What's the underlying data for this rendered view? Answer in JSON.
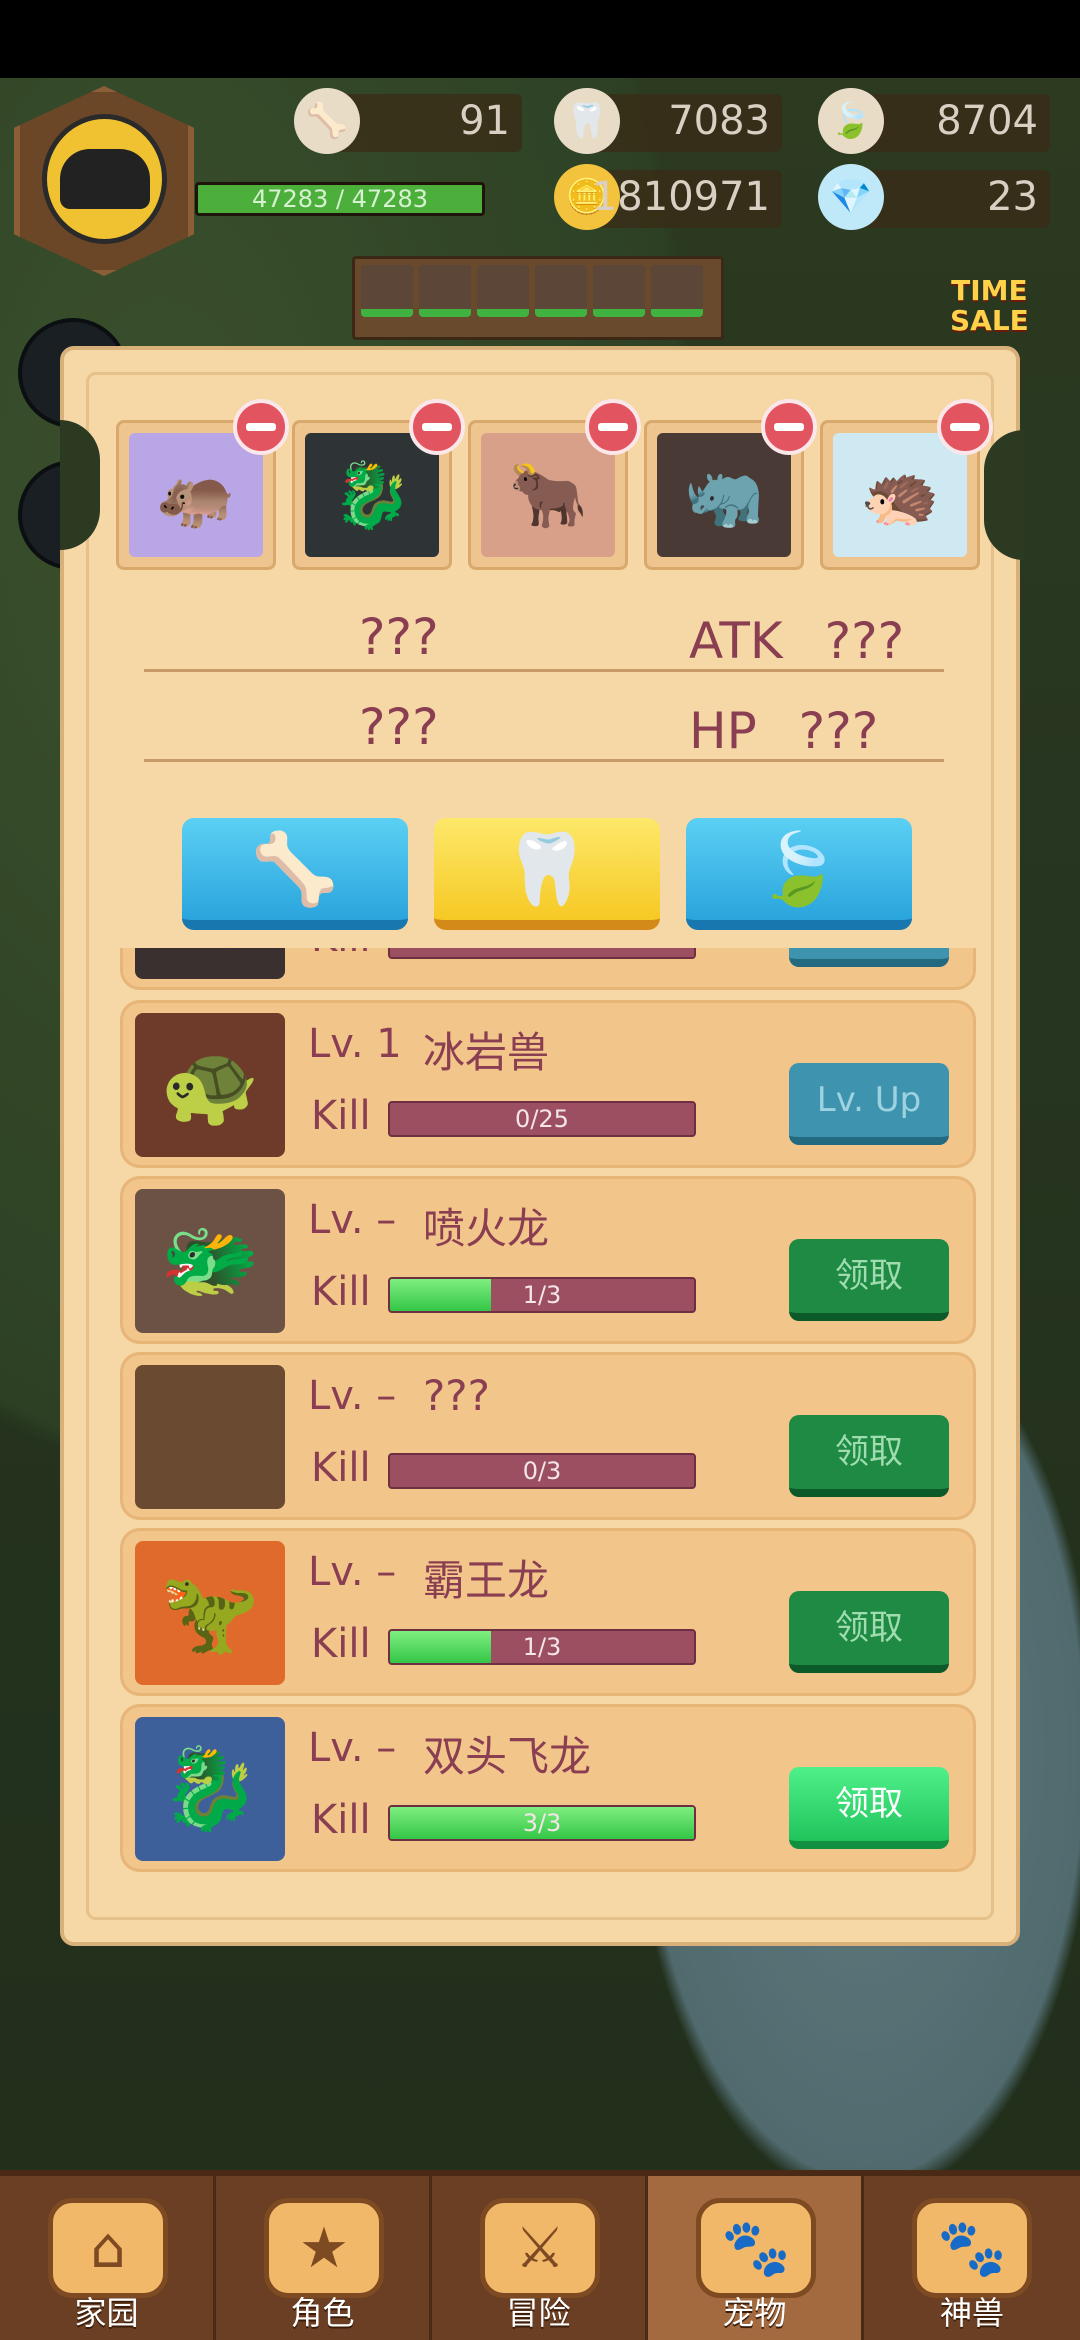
{
  "hud": {
    "hp_text": "47283 / 47283",
    "hp_fraction": 1.0,
    "resources": [
      {
        "icon": "bone-icon",
        "value": "91"
      },
      {
        "icon": "fang-icon",
        "value": "7083"
      },
      {
        "icon": "wing-icon",
        "value": "8704"
      },
      {
        "icon": "gold-icon",
        "value": "1810971"
      },
      {
        "icon": "gem-icon",
        "value": "23"
      }
    ],
    "time_sale": [
      "TIME",
      "SALE"
    ]
  },
  "panel": {
    "stats": [
      {
        "left": "???",
        "key": "ATK",
        "value": "???"
      },
      {
        "left": "???",
        "key": "HP",
        "value": "???"
      }
    ],
    "food_buttons": [
      {
        "name": "bone",
        "glyph": "🦴",
        "style": "blue"
      },
      {
        "name": "fang",
        "glyph": "🦷",
        "style": "yellow"
      },
      {
        "name": "wing",
        "glyph": "🍃",
        "style": "blue"
      }
    ],
    "partial_item": {
      "kill": "Kill"
    },
    "items": [
      {
        "lv": "Lv. 1",
        "name": "冰岩兽",
        "kill": "Kill",
        "progress": "0/25",
        "fraction": 0.0,
        "action": "Lv. Up",
        "action_style": "blue"
      },
      {
        "lv": "Lv. –",
        "name": "喷火龙",
        "kill": "Kill",
        "progress": "1/3",
        "fraction": 0.333,
        "action": "领取",
        "action_style": "dark"
      },
      {
        "lv": "Lv. –",
        "name": "???",
        "kill": "Kill",
        "progress": "0/3",
        "fraction": 0.0,
        "action": "领取",
        "action_style": "dark"
      },
      {
        "lv": "Lv. –",
        "name": "霸王龙",
        "kill": "Kill",
        "progress": "1/3",
        "fraction": 0.333,
        "action": "领取",
        "action_style": "dark"
      },
      {
        "lv": "Lv. –",
        "name": "双头飞龙",
        "kill": "Kill",
        "progress": "3/3",
        "fraction": 1.0,
        "action": "领取",
        "action_style": "bright"
      }
    ]
  },
  "nav": {
    "tabs": [
      {
        "label": "家园",
        "icon": "home-icon"
      },
      {
        "label": "角色",
        "icon": "cards-icon"
      },
      {
        "label": "冒险",
        "icon": "adventure-icon"
      },
      {
        "label": "宠物",
        "icon": "paw-icon",
        "active": true
      },
      {
        "label": "神兽",
        "icon": "banner-paw-icon"
      }
    ]
  }
}
